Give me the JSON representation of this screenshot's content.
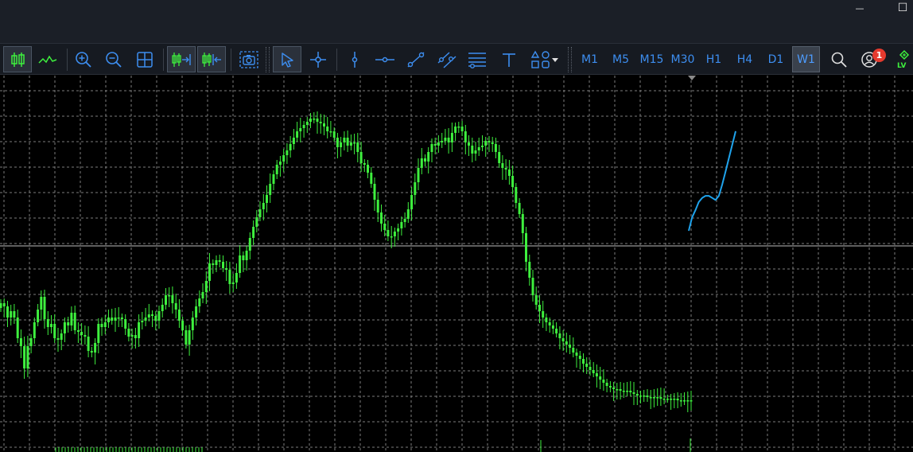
{
  "window": {
    "minimize_glyph": "—",
    "maximize_glyph": "☐"
  },
  "toolbar": {
    "tools": [
      {
        "id": "candles",
        "icon": "candlestick-chart-icon",
        "active": true
      },
      {
        "id": "line",
        "icon": "line-chart-icon",
        "active": false
      },
      {
        "id": "zoom-in",
        "icon": "zoom-in-icon",
        "active": false
      },
      {
        "id": "zoom-out",
        "icon": "zoom-out-icon",
        "active": false
      },
      {
        "id": "grid",
        "icon": "grid-icon",
        "active": false
      },
      {
        "id": "autoscroll",
        "icon": "auto-scroll-icon",
        "active": true
      },
      {
        "id": "chart-shift",
        "icon": "chart-shift-icon",
        "active": true
      },
      {
        "id": "screenshot",
        "icon": "screenshot-icon",
        "active": false
      },
      {
        "id": "cursor",
        "icon": "cursor-icon",
        "active": true
      },
      {
        "id": "crosshair",
        "icon": "crosshair-icon",
        "active": false
      },
      {
        "id": "vertical-line",
        "icon": "vertical-line-icon",
        "active": false
      },
      {
        "id": "horizontal-line",
        "icon": "horizontal-line-icon",
        "active": false
      },
      {
        "id": "trend-line",
        "icon": "trend-line-icon",
        "active": false
      },
      {
        "id": "channel",
        "icon": "equidistant-channel-icon",
        "active": false
      },
      {
        "id": "fibonacci",
        "icon": "fibonacci-icon",
        "active": false
      },
      {
        "id": "text",
        "icon": "text-icon",
        "active": false
      },
      {
        "id": "shapes",
        "icon": "shapes-icon",
        "active": false
      }
    ],
    "timeframes": [
      "M1",
      "M5",
      "M15",
      "M30",
      "H1",
      "H4",
      "D1",
      "W1"
    ],
    "active_timeframe": "W1",
    "notifications_count": "1"
  },
  "colors": {
    "candle": "#3ef03e",
    "grid": "#7b7b7b",
    "forecast": "#1fa3ec",
    "accent": "#3d8ef0"
  },
  "chart_data": {
    "type": "line",
    "series": [
      {
        "values": [
          0.62,
          0.6,
          0.53,
          0.57,
          0.53,
          0.4,
          0.35,
          0.21,
          0.35,
          0.4,
          0.5,
          0.58,
          0.66,
          0.52,
          0.47,
          0.49,
          0.4,
          0.39,
          0.43,
          0.5,
          0.48,
          0.56,
          0.45,
          0.44,
          0.42,
          0.41,
          0.32,
          0.31,
          0.37,
          0.49,
          0.47,
          0.5,
          0.53,
          0.51,
          0.53,
          0.53,
          0.52,
          0.46,
          0.41,
          0.42,
          0.4,
          0.5,
          0.51,
          0.53,
          0.55,
          0.54,
          0.51,
          0.57,
          0.61,
          0.67,
          0.67,
          0.62,
          0.58,
          0.51,
          0.45,
          0.36,
          0.45,
          0.53,
          0.6,
          0.65,
          0.69,
          0.76,
          0.87,
          0.86,
          0.89,
          0.88,
          0.84,
          0.83,
          0.74,
          0.75,
          0.81,
          0.92,
          0.89,
          0.95,
          1.03,
          1.1,
          1.16,
          1.21,
          1.25,
          1.3,
          1.37,
          1.43,
          1.49,
          1.51,
          1.55,
          1.58,
          1.62,
          1.66,
          1.7,
          1.72,
          1.74,
          1.76,
          1.78,
          1.78,
          1.76,
          1.75,
          1.73,
          1.7,
          1.7,
          1.66,
          1.6,
          1.63,
          1.66,
          1.61,
          1.63,
          1.63,
          1.57,
          1.5,
          1.49,
          1.44,
          1.37,
          1.27,
          1.19,
          1.12,
          1.08,
          1.04,
          1.04,
          1.07,
          1.09,
          1.13,
          1.15,
          1.21,
          1.3,
          1.38,
          1.47,
          1.53,
          1.51,
          1.57,
          1.62,
          1.61,
          1.63,
          1.64,
          1.66,
          1.63,
          1.69,
          1.73,
          1.73,
          1.7,
          1.63,
          1.61,
          1.56,
          1.58,
          1.6,
          1.61,
          1.64,
          1.63,
          1.62,
          1.57,
          1.5,
          1.47,
          1.46,
          1.42,
          1.35,
          1.25,
          1.18,
          1.06,
          0.88,
          0.78,
          0.67,
          0.61,
          0.57,
          0.53,
          0.5,
          0.48,
          0.46,
          0.43,
          0.4,
          0.38,
          0.36,
          0.34,
          0.31,
          0.29,
          0.27,
          0.24,
          0.22,
          0.2,
          0.18,
          0.16,
          0.14,
          0.12,
          0.1,
          0.09,
          0.08,
          0.08,
          0.07,
          0.07,
          0.07,
          0.06,
          0.05,
          0.04,
          0.04,
          0.04,
          0.03,
          0.03,
          0.03,
          0.03,
          0.02,
          0.02,
          0.02,
          0.02,
          0.02,
          0.01,
          0.01,
          0.01,
          0.01,
          0.01
        ]
      },
      {
        "name": "",
        "values": [
          1.0,
          0.87,
          0.8,
          0.72,
          0.68,
          0.66,
          0.66,
          0.68,
          0.7,
          0.66,
          0.55,
          0.42,
          0.29,
          0.16,
          0.03
        ]
      }
    ]
  }
}
